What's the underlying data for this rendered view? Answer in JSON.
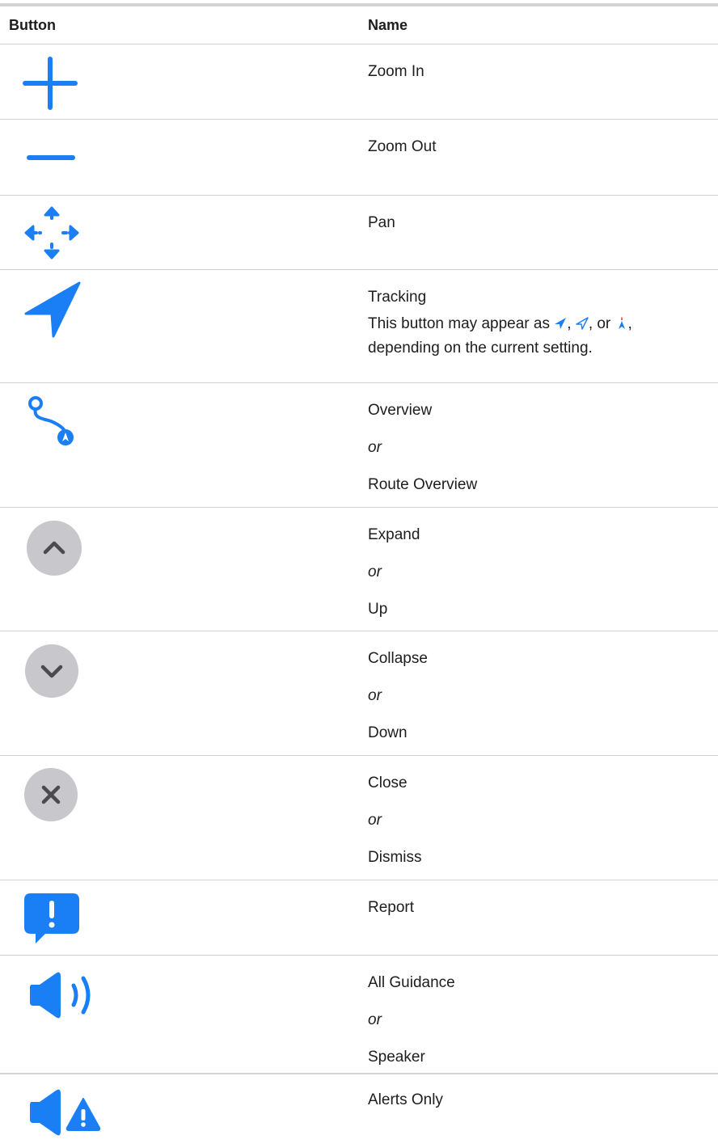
{
  "table": {
    "headers": {
      "button": "Button",
      "name": "Name"
    },
    "rows": [
      {
        "icon": "plus-icon",
        "names": [
          "Zoom In"
        ]
      },
      {
        "icon": "minus-icon",
        "names": [
          "Zoom Out"
        ]
      },
      {
        "icon": "pan-arrows-icon",
        "names": [
          "Pan"
        ]
      },
      {
        "icon": "location-arrow-icon",
        "names": [
          "Tracking"
        ],
        "description": {
          "before": "This button may appear as ",
          "sep1": ", ",
          "sep2": ", or ",
          "end": ",",
          "line2": "depending on the current setting."
        }
      },
      {
        "icon": "route-overview-icon",
        "names": [
          "Overview",
          "or",
          "Route Overview"
        ]
      },
      {
        "icon": "chevron-up-circle-icon",
        "names": [
          "Expand",
          "or",
          "Up"
        ]
      },
      {
        "icon": "chevron-down-circle-icon",
        "names": [
          "Collapse",
          "or",
          "Down"
        ]
      },
      {
        "icon": "close-circle-icon",
        "names": [
          "Close",
          "or",
          "Dismiss"
        ]
      },
      {
        "icon": "report-bubble-icon",
        "names": [
          "Report"
        ]
      },
      {
        "icon": "speaker-wave-icon",
        "names": [
          "All Guidance",
          "or",
          "Speaker"
        ]
      },
      {
        "icon": "speaker-alert-icon",
        "names": [
          "Alerts Only"
        ]
      }
    ]
  },
  "colors": {
    "accent_blue": "#1a7ef5",
    "gray_circle": "#c7c7cc",
    "gray_glyph": "#4a4a4f",
    "divider": "#d2d2d7"
  }
}
